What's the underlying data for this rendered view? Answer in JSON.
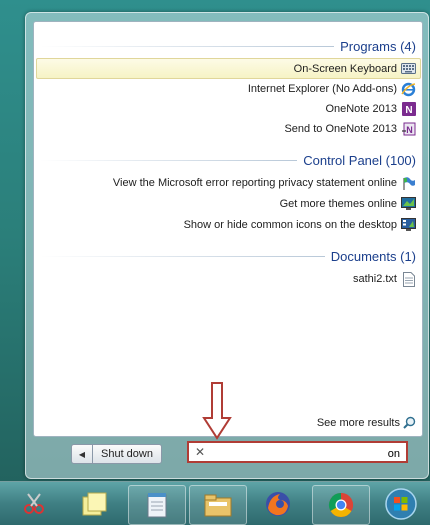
{
  "sections": {
    "programs": {
      "header": "Programs (4)",
      "items": [
        {
          "label": "On-Screen Keyboard",
          "icon": "keyboard-icon",
          "selected": true
        },
        {
          "label": "Internet Explorer (No Add-ons)",
          "icon": "internet-explorer-icon"
        },
        {
          "label": "OneNote 2013",
          "icon": "onenote-icon"
        },
        {
          "label": "Send to OneNote 2013",
          "icon": "send-to-onenote-icon"
        }
      ]
    },
    "control_panel": {
      "header": "Control Panel (100)",
      "items": [
        {
          "label": "View the Microsoft error reporting privacy statement online",
          "icon": "flag-icon"
        },
        {
          "label": "Get more themes online",
          "icon": "monitor-icon"
        },
        {
          "label": "Show or hide common icons on the desktop",
          "icon": "desktop-icons-icon"
        }
      ]
    },
    "documents": {
      "header": "Documents (1)",
      "items": [
        {
          "label": "sathi2.txt",
          "icon": "text-file-icon"
        }
      ]
    }
  },
  "see_more": "See more results",
  "search": {
    "value": "on"
  },
  "shutdown": {
    "label": "Shut down"
  },
  "colors": {
    "accent": "#1b3f8c",
    "annotation": "#b03c35",
    "selected_bg": "#f6f3c5"
  },
  "taskbar": {
    "items": [
      "snipping-tool-icon",
      "sticky-notes-icon",
      "notepad-icon",
      "file-explorer-icon",
      "firefox-icon",
      "chrome-icon",
      "start-orb-icon"
    ]
  }
}
